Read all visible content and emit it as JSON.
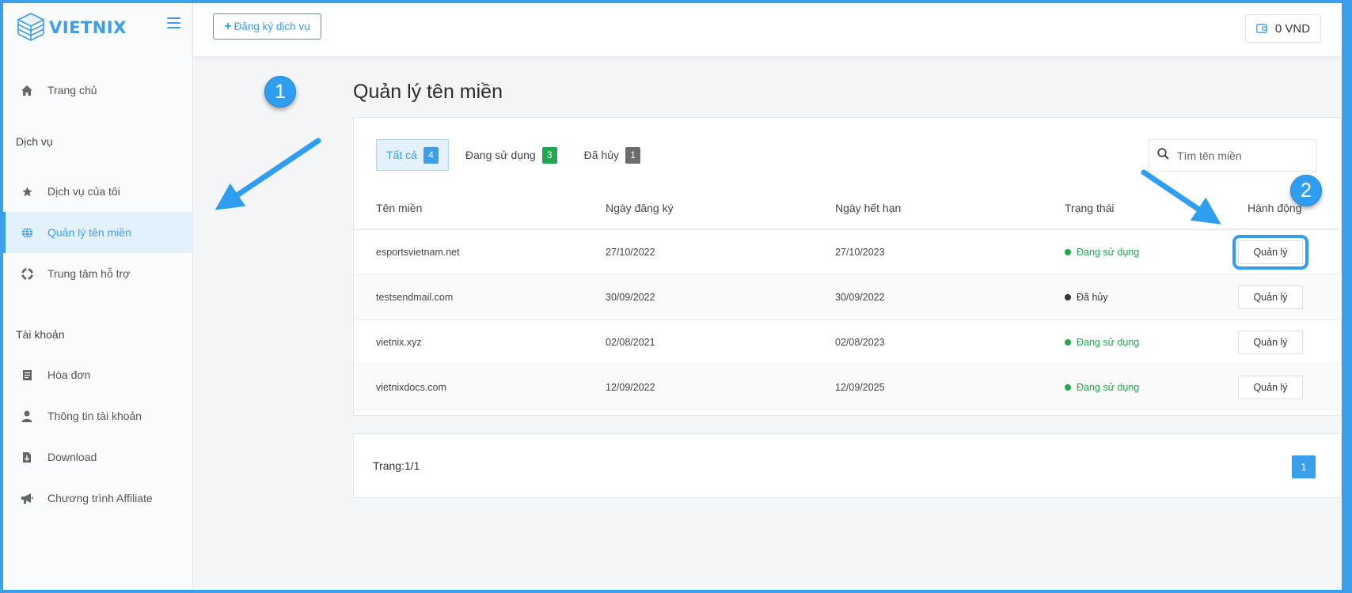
{
  "brand": {
    "name": "VIETNIX",
    "color": "#3a9ee8"
  },
  "sidebar": {
    "home": {
      "label": "Trang chủ",
      "icon": "home-icon"
    },
    "section_services": "Dịch vụ",
    "services": [
      {
        "label": "Dịch vụ của tôi",
        "icon": "star-icon"
      },
      {
        "label": "Quản lý tên miền",
        "icon": "globe-icon",
        "active": true
      },
      {
        "label": "Trung tâm hỗ trợ",
        "icon": "lifebuoy-icon"
      }
    ],
    "section_account": "Tài khoản",
    "account": [
      {
        "label": "Hóa đơn",
        "icon": "invoice-icon"
      },
      {
        "label": "Thông tin tài khoản",
        "icon": "user-icon"
      },
      {
        "label": "Download",
        "icon": "file-download-icon"
      },
      {
        "label": "Chương trình Affiliate",
        "icon": "megaphone-icon"
      }
    ]
  },
  "topbar": {
    "register_label": "Đăng ký dịch vụ",
    "balance": "0 VND"
  },
  "main": {
    "title": "Quản lý tên miền",
    "tabs": [
      {
        "label": "Tất cả",
        "count": "4"
      },
      {
        "label": "Đang sử dụng",
        "count": "3"
      },
      {
        "label": "Đã hủy",
        "count": "1"
      }
    ],
    "search_placeholder": "Tìm tên miền",
    "columns": [
      "Tên miền",
      "Ngày đăng ký",
      "Ngày hết hạn",
      "Trạng thái",
      "Hành động"
    ],
    "rows": [
      {
        "domain": "esportsvietnam.net",
        "registered": "27/10/2022",
        "expires": "27/10/2023",
        "status": "Đang sử dụng",
        "action": "Quản lý"
      },
      {
        "domain": "testsendmail.com",
        "registered": "30/09/2022",
        "expires": "30/09/2022",
        "status": "Đã hủy",
        "action": "Quản lý"
      },
      {
        "domain": "vietnix.xyz",
        "registered": "02/08/2021",
        "expires": "02/08/2023",
        "status": "Đang sử dụng",
        "action": "Quản lý"
      },
      {
        "domain": "vietnixdocs.com",
        "registered": "12/09/2022",
        "expires": "12/09/2025",
        "status": "Đang sử dụng",
        "action": "Quản lý"
      }
    ],
    "pager_label": "Trang:1/1",
    "current_page": "1"
  },
  "annotations": {
    "marker1": "1",
    "marker2": "2"
  },
  "colors": {
    "accent": "#3a9ee8",
    "success": "#1fa84f",
    "annotation": "#2f9ef0"
  }
}
